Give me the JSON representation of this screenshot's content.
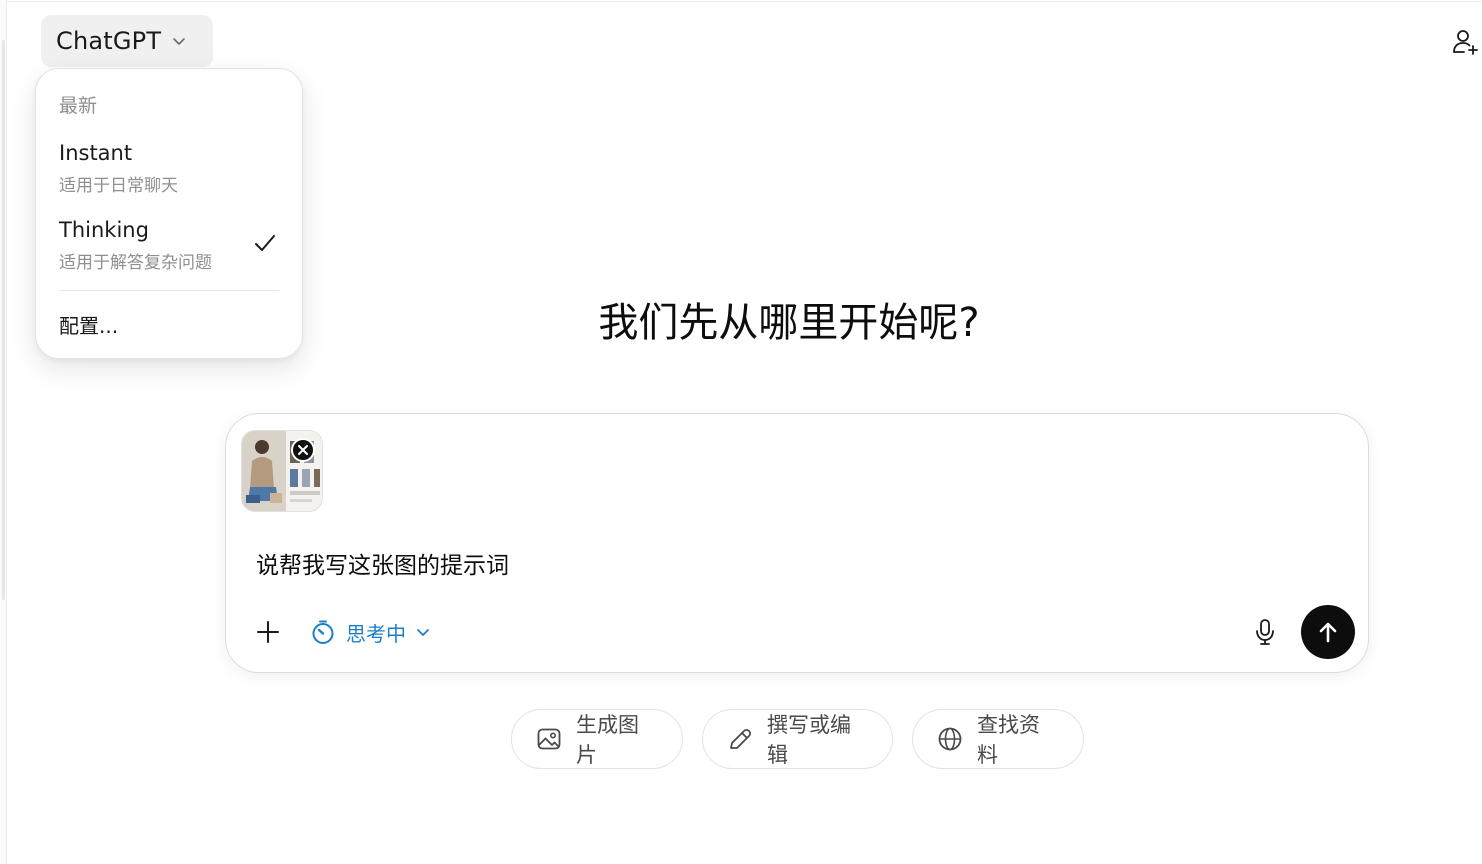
{
  "header": {
    "model_name": "ChatGPT",
    "chevron_icon": "chevron-down-icon",
    "add_user_icon": "person-add-icon"
  },
  "model_menu": {
    "section_label": "最新",
    "options": [
      {
        "title": "Instant",
        "subtitle": "适用于日常聊天",
        "selected": false
      },
      {
        "title": "Thinking",
        "subtitle": "适用于解答复杂问题",
        "selected": true
      }
    ],
    "configure_label": "配置..."
  },
  "main": {
    "headline": "我们先从哪里开始呢?"
  },
  "composer": {
    "attachment_icon": "image-thumbnail",
    "remove_icon": "close-icon",
    "prompt_value": "说帮我写这张图的提示词",
    "plus_icon": "plus-icon",
    "mode_label": "思考中",
    "mode_icon": "timer-icon",
    "mic_icon": "microphone-icon",
    "send_icon": "arrow-up-icon"
  },
  "suggestions": [
    {
      "label": "生成图片",
      "icon": "image-icon"
    },
    {
      "label": "撰写或编辑",
      "icon": "pencil-icon"
    },
    {
      "label": "查找资料",
      "icon": "globe-icon"
    }
  ],
  "colors": {
    "accent_blue": "#1d7fc9",
    "send_button": "#0d0d0d",
    "muted_text": "#8f8f8f"
  }
}
